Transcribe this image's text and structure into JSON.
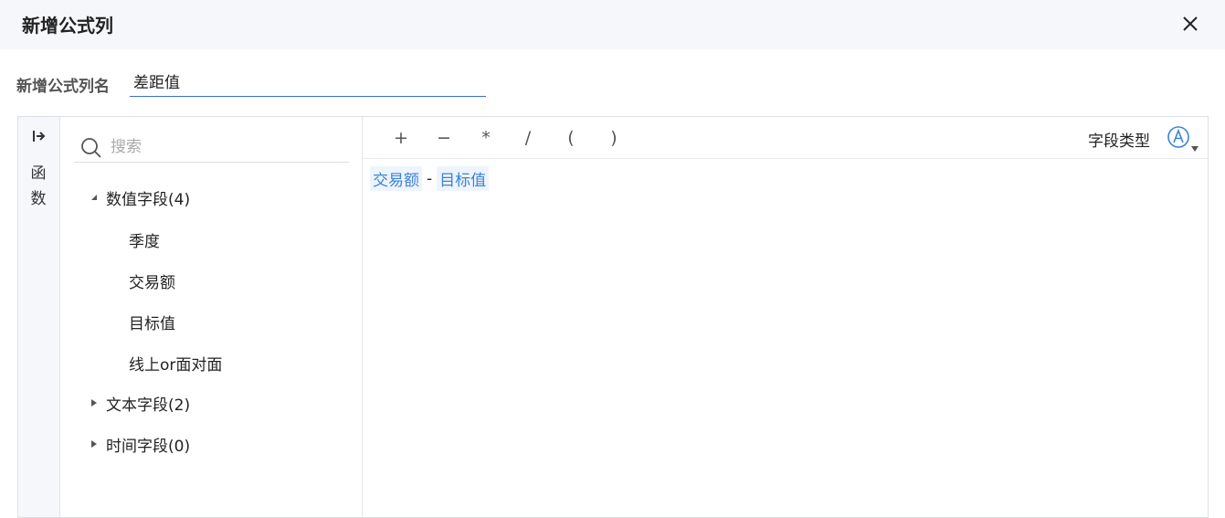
{
  "dialog": {
    "title": "新增公式列"
  },
  "name_field": {
    "label": "新增公式列名",
    "value": "差距值"
  },
  "sidebar_strip": {
    "label_1": "函",
    "label_2": "数"
  },
  "search": {
    "placeholder": "搜索"
  },
  "field_groups": [
    {
      "label": "数值字段(4)",
      "expanded": true,
      "items": [
        "季度",
        "交易额",
        "目标值",
        "线上or面对面"
      ]
    },
    {
      "label": "文本字段(2)",
      "expanded": false
    },
    {
      "label": "时间字段(0)",
      "expanded": false
    }
  ],
  "operators": [
    "+",
    "−",
    "*",
    "/",
    "(",
    ")"
  ],
  "field_type": {
    "label": "字段类型",
    "icon": "text-type-icon"
  },
  "formula": {
    "token_1": "交易额",
    "operator": "-",
    "token_2": "目标值"
  },
  "colors": {
    "accent": "#3a84d6",
    "underline": "#3a6fd8",
    "header_bg": "#f6f7fb",
    "token_bg": "#eef4fb"
  }
}
